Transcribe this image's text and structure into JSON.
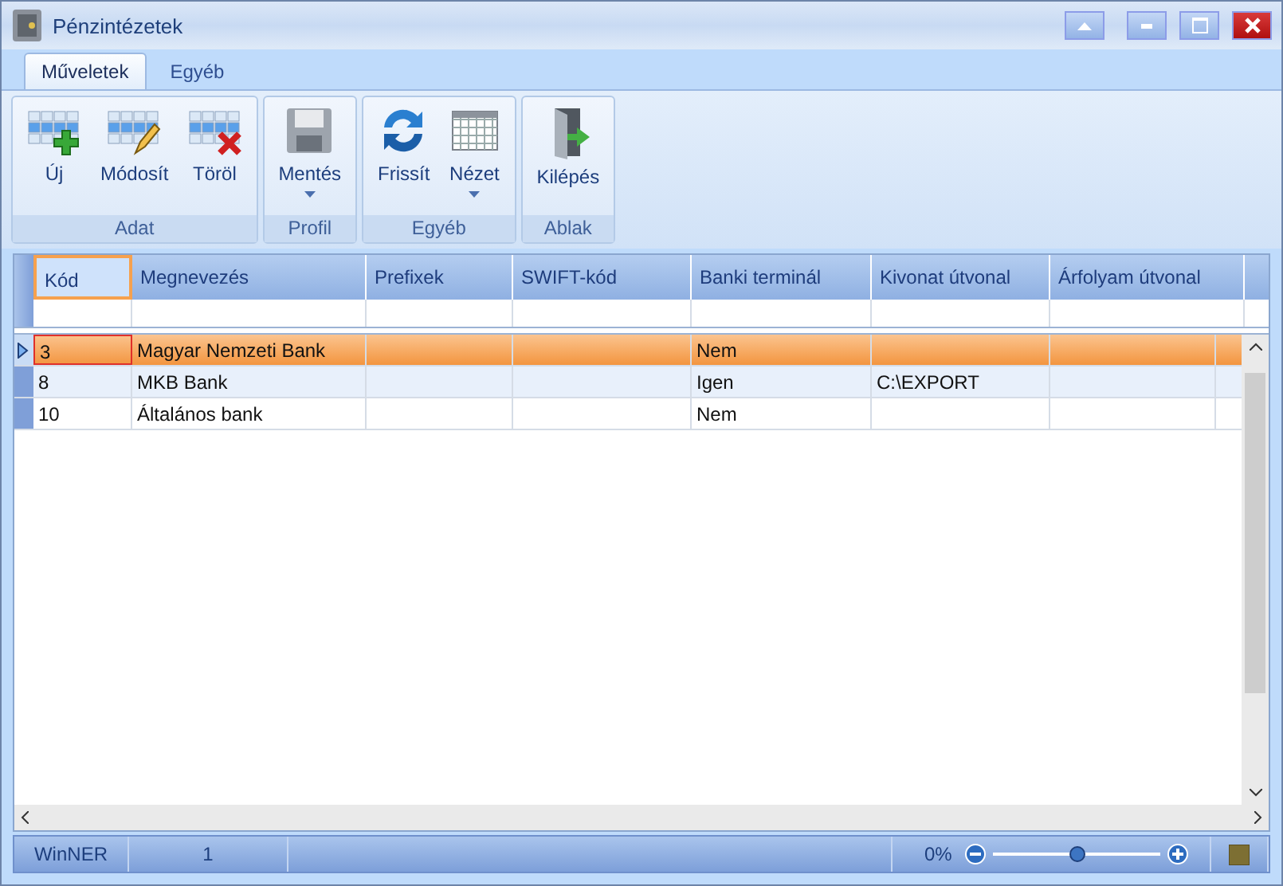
{
  "window": {
    "title": "Pénzintézetek"
  },
  "tabs": [
    {
      "label": "Műveletek",
      "selected": true
    },
    {
      "label": "Egyéb",
      "selected": false
    }
  ],
  "ribbon_groups": [
    {
      "label": "Adat",
      "buttons": [
        {
          "label": "Új",
          "kind": "new",
          "dropdown": false
        },
        {
          "label": "Módosít",
          "kind": "edit",
          "dropdown": false
        },
        {
          "label": "Töröl",
          "kind": "delete",
          "dropdown": false
        }
      ]
    },
    {
      "label": "Profil",
      "buttons": [
        {
          "label": "Mentés",
          "kind": "save",
          "dropdown": true
        }
      ]
    },
    {
      "label": "Egyéb",
      "buttons": [
        {
          "label": "Frissít",
          "kind": "refresh",
          "dropdown": false
        },
        {
          "label": "Nézet",
          "kind": "view",
          "dropdown": true
        }
      ]
    },
    {
      "label": "Ablak",
      "buttons": [
        {
          "label": "Kilépés",
          "kind": "exit",
          "dropdown": false
        }
      ]
    }
  ],
  "table": {
    "columns": [
      "Kód",
      "Megnevezés",
      "Prefixek",
      "SWIFT-kód",
      "Banki terminál",
      "Kivonat útvonal",
      "Árfolyam útvonal"
    ],
    "rows": [
      {
        "selected": true,
        "cells": [
          "3",
          "Magyar Nemzeti Bank",
          "",
          "",
          "Nem",
          "",
          ""
        ]
      },
      {
        "selected": false,
        "cells": [
          "8",
          "MKB Bank",
          "",
          "",
          "Igen",
          "C:\\EXPORT",
          ""
        ]
      },
      {
        "selected": false,
        "cells": [
          "10",
          "Általános bank",
          "",
          "",
          "Nem",
          "",
          ""
        ]
      }
    ]
  },
  "status_bar": {
    "app": "WinNER",
    "count": "1",
    "zoom": "0%",
    "zoom_slider": {
      "level": 0.5
    }
  }
}
